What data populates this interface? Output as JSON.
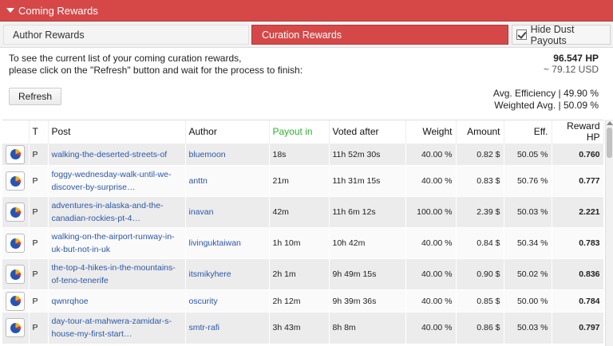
{
  "title": "Coming Rewards",
  "tabs": {
    "author": "Author Rewards",
    "curation": "Curation Rewards",
    "dust": "Hide Dust Payouts"
  },
  "info": {
    "line1": "To see the current list of your coming curation rewards,",
    "line2": "please click on the \"Refresh\" button and wait for the process to finish:"
  },
  "refresh_label": "Refresh",
  "summary": {
    "hp": "96.547 HP",
    "usd": "~ 79.12 USD",
    "avg_eff": "Avg. Efficiency | 49.90 %",
    "weighted": "Weighted Avg. | 50.09 %"
  },
  "table": {
    "headers": {
      "t": "T",
      "post": "Post",
      "author": "Author",
      "payout": "Payout in",
      "voted": "Voted after",
      "weight": "Weight",
      "amount": "Amount",
      "eff": "Eff.",
      "reward": "Reward HP"
    },
    "rows": [
      {
        "t": "P",
        "post": "walking-the-deserted-streets-of",
        "author": "bluemoon",
        "payout": "18s",
        "voted": "11h 52m 30s",
        "weight": "40.00 %",
        "amount": "0.82 $",
        "eff": "50.05 %",
        "reward": "0.760"
      },
      {
        "t": "P",
        "post": "foggy-wednesday-walk-until-we-discover-by-surprise…",
        "author": "anttn",
        "payout": "21m",
        "voted": "11h 31m 15s",
        "weight": "40.00 %",
        "amount": "0.83 $",
        "eff": "50.76 %",
        "reward": "0.777"
      },
      {
        "t": "P",
        "post": "adventures-in-alaska-and-the-canadian-rockies-pt-4…",
        "author": "inavan",
        "payout": "42m",
        "voted": "11h 6m 12s",
        "weight": "100.00 %",
        "amount": "2.39 $",
        "eff": "50.03 %",
        "reward": "2.221"
      },
      {
        "t": "P",
        "post": "walking-on-the-airport-runway-in-uk-but-not-in-uk",
        "author": "livinguktaiwan",
        "payout": "1h 10m",
        "voted": "10h 42m",
        "weight": "40.00 %",
        "amount": "0.84 $",
        "eff": "50.34 %",
        "reward": "0.783"
      },
      {
        "t": "P",
        "post": "the-top-4-hikes-in-the-mountains-of-teno-tenerife",
        "author": "itsmikyhere",
        "payout": "2h 1m",
        "voted": "9h 49m 15s",
        "weight": "40.00 %",
        "amount": "0.90 $",
        "eff": "50.02 %",
        "reward": "0.836"
      },
      {
        "t": "P",
        "post": "qwnrqhoe",
        "author": "oscurity",
        "payout": "2h 12m",
        "voted": "9h 39m 36s",
        "weight": "40.00 %",
        "amount": "0.85 $",
        "eff": "50.00 %",
        "reward": "0.784"
      },
      {
        "t": "P",
        "post": "day-tour-at-mahwera-zamidar-s-house-my-first-start…",
        "author": "smtr-rafi",
        "payout": "3h 43m",
        "voted": "8h 8m",
        "weight": "40.00 %",
        "amount": "0.86 $",
        "eff": "50.03 %",
        "reward": "0.797"
      }
    ]
  }
}
